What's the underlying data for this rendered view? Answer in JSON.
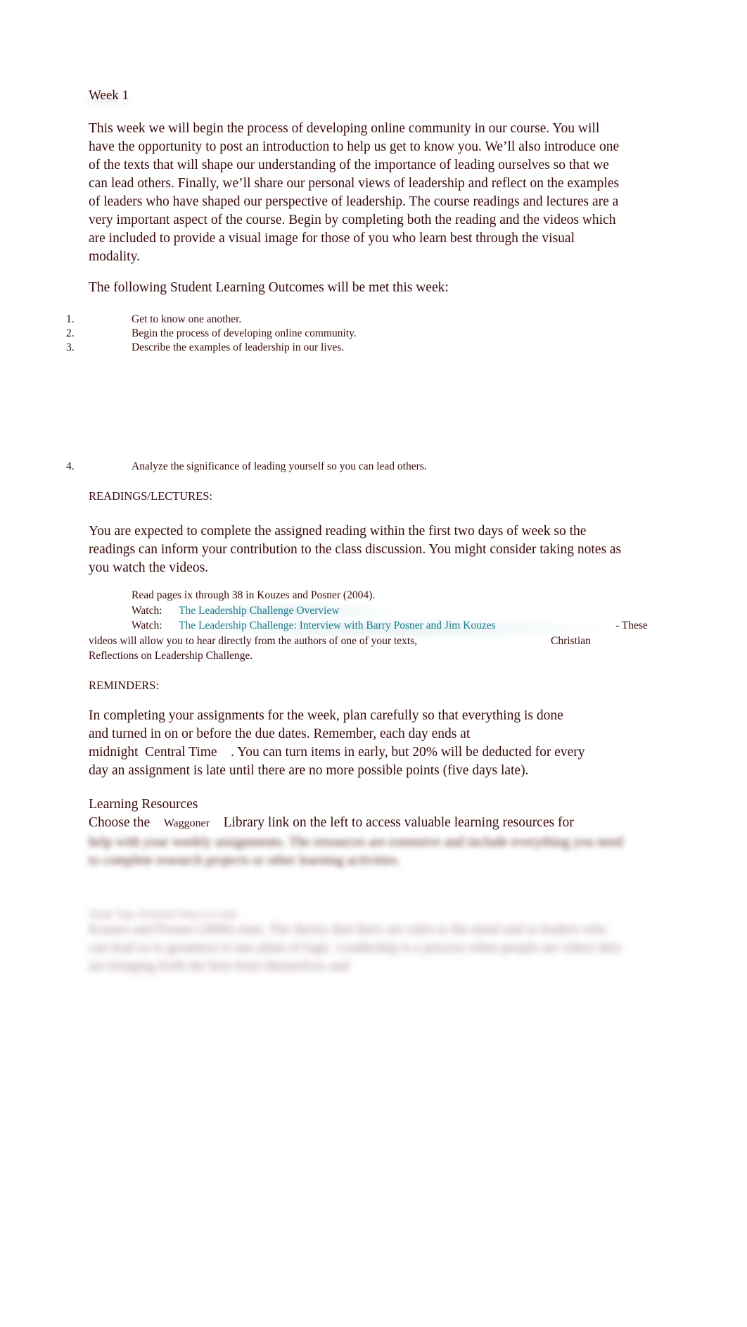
{
  "header": {
    "week_title": "Week 1"
  },
  "intro": {
    "paragraph": "This week we will begin the process of developing online community in our course. You will have the opportunity to post an introduction to help us get to know you. We’ll also introduce one of the texts that will shape our understanding of the importance of leading ourselves so that we can lead others. Finally, we’ll share our personal views of leadership and reflect on the examples of leaders who have shaped our perspective of leadership. The course readings and lectures are a very important aspect of the course. Begin by completing both the reading and the videos which are included to provide a visual image for those of you who learn best through the visual modality."
  },
  "outcomes": {
    "heading": "The following Student Learning Outcomes will be met this week:",
    "items": [
      {
        "num": "1.",
        "text": "Get to know one another."
      },
      {
        "num": "2.",
        "text": "Begin the process of developing online community."
      },
      {
        "num": "3.",
        "text": "Describe the examples of leadership in our lives."
      },
      {
        "num": "4.",
        "text": "Analyze the significance of leading yourself so you can lead others."
      }
    ]
  },
  "readings": {
    "heading": "READINGS/LECTURES:",
    "paragraph": "You are expected to complete the assigned reading within the first two days of week so the readings can inform your contribution to the class discussion. You might consider taking notes as you watch the videos.",
    "bullet_glyph": "",
    "items": [
      {
        "text": "Read pages ix through 38 in Kouzes and Posner (2004)."
      },
      {
        "prefix": "Watch:",
        "link": "The Leadership Challenge Overview"
      },
      {
        "prefix": "Watch:",
        "link": "The Leadership Challenge: Interview with Barry Posner and Jim Kouzes",
        "suffix": "- These"
      }
    ],
    "continuation_line1": "videos will allow you to hear directly from the authors of one of your texts,",
    "continuation_word": "Christian",
    "continuation_line2": "Reflections on Leadership Challenge."
  },
  "reminders": {
    "heading": "REMINDERS:",
    "line1": "In completing your assignments for the week, plan carefully so that everything is done",
    "line2": "and turned in on or before the due dates. Remember, each day ends at",
    "line3_a": "midnight",
    "line3_b": "Central Time",
    "line3_c": ". You can turn items in early, but 20% will be deducted for every",
    "line4": "day an assignment is late until there are no more possible points (five days late)."
  },
  "resources": {
    "heading": "Learning Resources",
    "line1_a": "Choose the",
    "line1_b": "Waggoner",
    "line1_c": "Library link on the left to access valuable learning resources for",
    "blurred_1": "help with your weekly assignments. The resources are extensive and include everything you need to complete research projects or other learning activities.",
    "blurred_2_head": "Study Tips: Personal Ways to Lead",
    "blurred_2": "Kouzes and Posner (2004) state, The theory that there are rules to the mind and to leaders who can lead us to greatness is one plain of logic. Leadership is a process when people are where they are bringing forth the best from themselves and"
  }
}
